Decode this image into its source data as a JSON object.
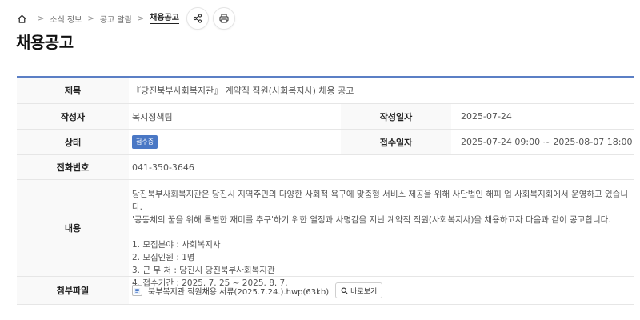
{
  "breadcrumb": {
    "items": [
      "소식 정보",
      "공고 알림",
      "채용공고"
    ],
    "separator": ">"
  },
  "icons": {
    "home": "home-icon",
    "share": "share-icon",
    "print": "print-icon",
    "file": "hwp-file-icon",
    "search": "search-icon"
  },
  "page": {
    "title": "채용공고"
  },
  "detail": {
    "title_label": "제목",
    "title_value": "『당진북부사회복지관』 계약직 직원(사회복지사) 채용 공고",
    "author_label": "작성자",
    "author_value": "복지정책팀",
    "date_label": "작성일자",
    "date_value": "2025-07-24",
    "status_label": "상태",
    "status_value": "접수중",
    "period_label": "접수일자",
    "period_value": "2025-07-24 09:00 ~ 2025-08-07 18:00",
    "phone_label": "전화번호",
    "phone_value": "041-350-3646",
    "content_label": "내용",
    "content_lines": [
      "당진북부사회복지관은 당진시 지역주민의 다양한 사회적 욕구에 맞춤형 서비스 제공을 위해 사단법인 해피 업 사회복지회에서 운영하고 있습니다.",
      "'공동체의 꿈을 위해 특별한 재미를 추구'하기 위한 열정과 사명감을 지닌 계약직 직원(사회복지사)을 채용하고자 다음과 같이 공고합니다.",
      "",
      "1. 모집분야 : 사회복지사",
      "2. 모집인원 : 1명",
      "3. 근 무 처 : 당진시 당진북부사회복지관",
      "4. 접수기간 : 2025. 7. 25 ~ 2025. 8. 7."
    ],
    "file_label": "첨부파일",
    "file_name": "북부복지관 직원채용 서류(2025.7.24.).hwp(63kb)",
    "view_button": "바로보기"
  },
  "colors": {
    "accent": "#5b7fc5",
    "badge": "#4a78c5"
  }
}
